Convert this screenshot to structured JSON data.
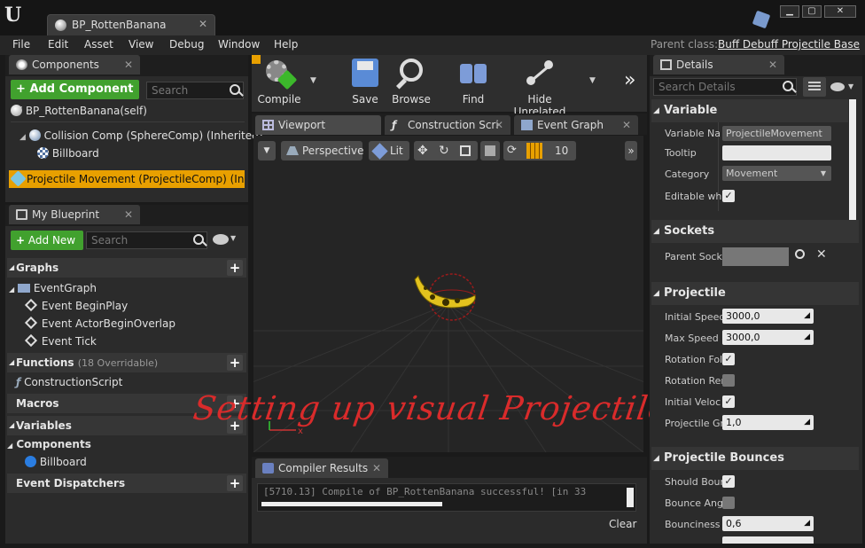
{
  "window": {
    "tab_title": "BP_RottenBanana",
    "minimize": "▁",
    "maximize": "▢",
    "close": "✕"
  },
  "menu": [
    "File",
    "Edit",
    "Asset",
    "View",
    "Debug",
    "Window",
    "Help"
  ],
  "parent_class": {
    "label": "Parent class:",
    "value": "Buff Debuff Projectile Base"
  },
  "components_panel": {
    "tab": "Components",
    "add_button": "Add Component",
    "search_placeholder": "Search",
    "items": [
      "BP_RottenBanana(self)",
      "Collision Comp (SphereComp) (Inherited)",
      "Billboard",
      "Projectile Movement (ProjectileComp) (Inherited)"
    ]
  },
  "my_blueprint": {
    "tab": "My Blueprint",
    "add_new": "Add New",
    "search_placeholder": "Search",
    "graphs_label": "Graphs",
    "event_graph": "EventGraph",
    "events": [
      "Event BeginPlay",
      "Event ActorBeginOverlap",
      "Event Tick"
    ],
    "functions_label": "Functions",
    "functions_count": "(18 Overridable)",
    "construction_script": "ConstructionScript",
    "macros_label": "Macros",
    "variables_label": "Variables",
    "components_label": "Components",
    "billboard": "Billboard",
    "dispatchers_label": "Event Dispatchers"
  },
  "toolbar": {
    "compile": "Compile",
    "save": "Save",
    "browse": "Browse",
    "find": "Find",
    "hide_unrelated": "Hide Unrelated"
  },
  "editor_tabs": {
    "viewport": "Viewport",
    "construction": "Construction Scri",
    "event_graph": "Event Graph"
  },
  "viewport": {
    "perspective": "Perspective",
    "lit": "Lit",
    "grid_snap": "10"
  },
  "overlay_caption": "Setting up visual ProjectileCarrier",
  "compiler": {
    "tab": "Compiler Results",
    "message": "[5710.13] Compile of BP_RottenBanana successful! [in 33",
    "clear": "Clear"
  },
  "details": {
    "tab": "Details",
    "search_placeholder": "Search Details",
    "variable_section": "Variable",
    "variable_name_label": "Variable Na",
    "variable_name_value": "ProjectileMovement",
    "tooltip_label": "Tooltip",
    "category_label": "Category",
    "category_value": "Movement",
    "editable_label": "Editable whe",
    "sockets_section": "Sockets",
    "parent_socket_label": "Parent Sock",
    "projectile_section": "Projectile",
    "initial_speed_label": "Initial Speed",
    "initial_speed_value": "3000,0",
    "max_speed_label": "Max Speed",
    "max_speed_value": "3000,0",
    "rotation_follows_label": "Rotation Fol",
    "rotation_remains_label": "Rotation Rer",
    "initial_velocity_label": "Initial Veloc",
    "gravity_label": "Projectile Gr",
    "gravity_value": "1,0",
    "bounces_section": "Projectile Bounces",
    "should_bounce_label": "Should Boun",
    "bounce_angle_label": "Bounce Ang",
    "bounciness_label": "Bounciness",
    "bounciness_value": "0,6"
  },
  "colors": {
    "accent_green": "#41a12e",
    "selection_orange": "#e8a000",
    "caption_red": "#d92b2b"
  }
}
